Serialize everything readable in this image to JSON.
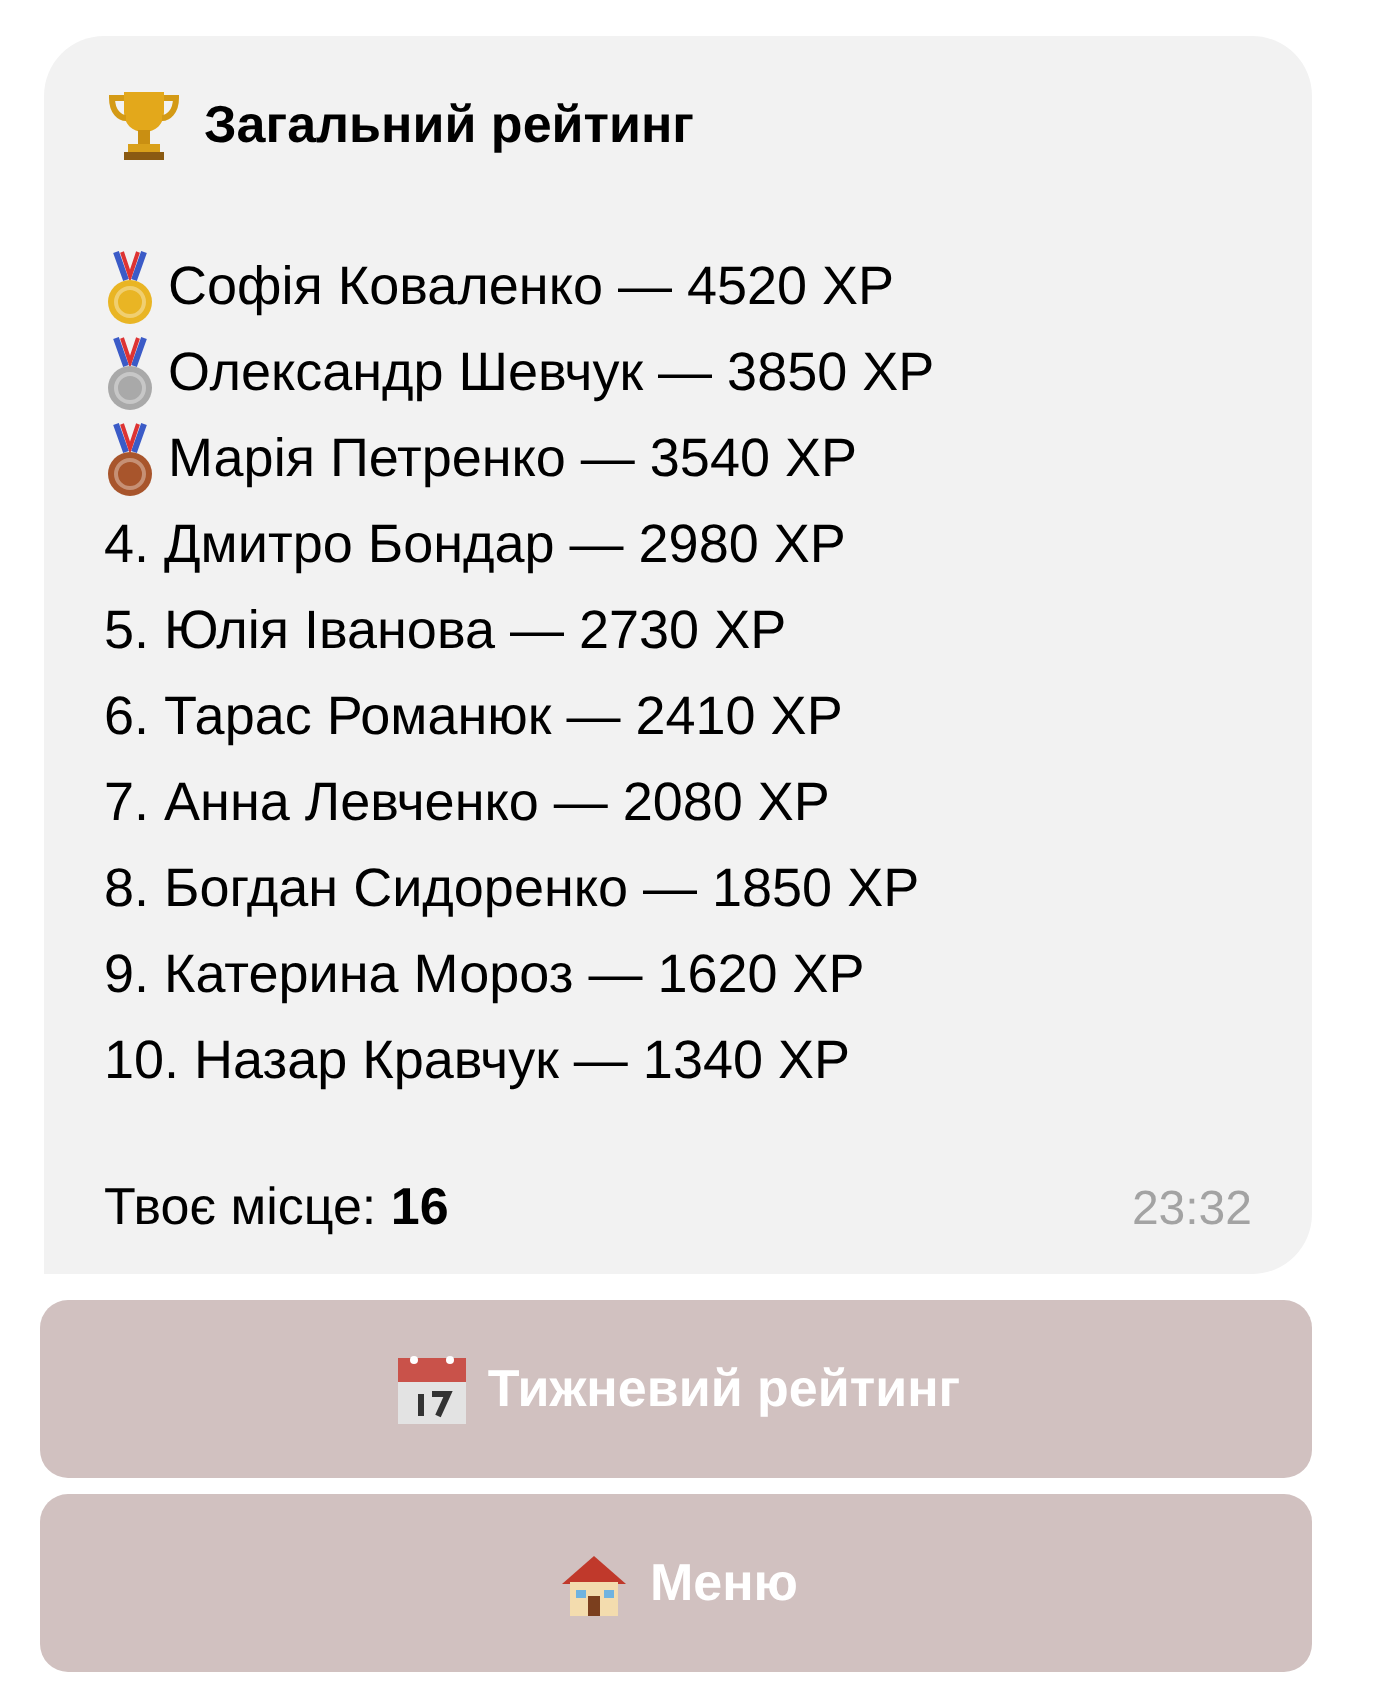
{
  "message": {
    "title": "Загальний рейтинг",
    "entries": [
      {
        "kind": "medal",
        "color": "#e9b524",
        "text": "Софія Коваленко — 4520 XP"
      },
      {
        "kind": "medal",
        "color": "#a9a9a9",
        "text": "Олександр Шевчук — 3850 XP"
      },
      {
        "kind": "medal",
        "color": "#a8552c",
        "text": "Марія Петренко — 3540 XP"
      },
      {
        "kind": "plain",
        "text": "4. Дмитро Бондар — 2980 XP"
      },
      {
        "kind": "plain",
        "text": "5. Юлія Іванова — 2730 XP"
      },
      {
        "kind": "plain",
        "text": "6. Тарас Романюк — 2410 XP"
      },
      {
        "kind": "plain",
        "text": "7. Анна Левченко — 2080 XP"
      },
      {
        "kind": "plain",
        "text": "8. Богдан Сидоренко — 1850 XP"
      },
      {
        "kind": "plain",
        "text": "9. Катерина Мороз — 1620 XP"
      },
      {
        "kind": "plain",
        "text": "10. Назар Кравчук — 1340 XP"
      }
    ],
    "footer": "Твоє місце: **16**",
    "time": "23:32"
  },
  "buttons": [
    {
      "kind": "calendar",
      "label": "Тижневий рейтинг"
    },
    {
      "kind": "home",
      "label": "Меню"
    }
  ]
}
